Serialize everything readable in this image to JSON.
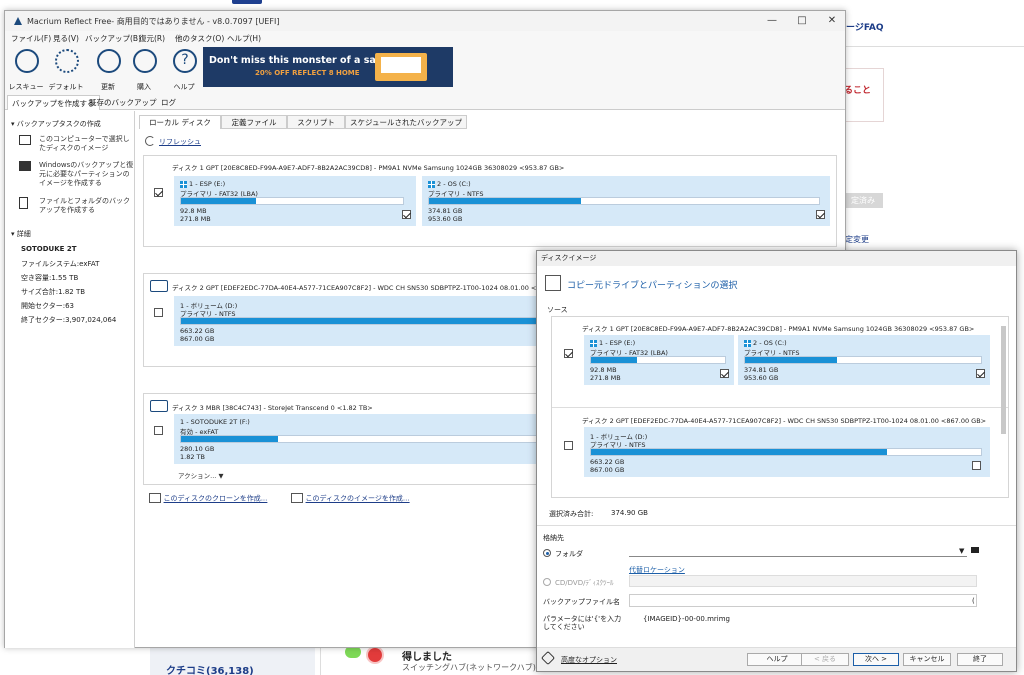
{
  "web": {
    "faq": "ージFAQ",
    "red_text": "ること",
    "btn": "定済み",
    "link": "定変更",
    "review": "クチコミ(36,138)",
    "gain": "得しました",
    "switch": "スイッチングハブ(ネットワークハブ)"
  },
  "main": {
    "title": "Macrium Reflect Free- 商用目的ではありません - v8.0.7097 [UEFI]",
    "menu": [
      "ファイル(F)",
      "見る(V)",
      "バックアップ(B)",
      "復元(R)",
      "他のタスク(O)",
      "ヘルプ(H)"
    ],
    "toolbar": [
      "レスキュー",
      "デフォルト",
      "更新",
      "購入",
      "ヘルプ"
    ],
    "ad_line1": "Don't miss this monster of a sale!",
    "ad_line2": "20% OFF REFLECT 8 HOME",
    "subtabs": [
      "バックアップを作成する",
      "既存のバックアップ",
      "ログ"
    ],
    "left": {
      "head": "バックアップタスクの作成",
      "tasks": [
        "このコンピューターで選択したディスクのイメージ",
        "Windowsのバックアップと復元に必要なパーティションのイメージを作成する",
        "ファイルとフォルダのバックアップを作成する"
      ],
      "detail_head": "詳細",
      "details": [
        "SOTODUKE 2T",
        "ファイルシステム:exFAT",
        "空き容量:1.55 TB",
        "サイズ合計:1.82 TB",
        "開始セクター:63",
        "終了セクター:3,907,024,064"
      ]
    },
    "tabs": [
      "ローカル ディスク",
      "定義ファイル",
      "スクリプト",
      "スケジュールされたバックアップ"
    ],
    "refresh": "リフレッシュ",
    "disks": [
      {
        "title": "ディスク 1 GPT [20E8C8ED-F99A-A9E7-ADF7-8B2A2AC39CD8] - PM9A1 NVMe Samsung 1024GB 36308029  <953.87 GB>",
        "checked": true,
        "parts": [
          {
            "name": "1 - ESP (E:)",
            "type": "プライマリ - FAT32 (LBA)",
            "used": "92.8 MB",
            "total": "271.8 MB",
            "fill": 0.34,
            "checked": true
          },
          {
            "name": "2 - OS (C:)",
            "type": "プライマリ - NTFS",
            "used": "374.81 GB",
            "total": "953.60 GB",
            "fill": 0.39,
            "checked": true
          }
        ]
      },
      {
        "title": "ディスク 2 GPT [EDEF2EDC-77DA-40E4-A577-71CEA907C8F2] - WDC CH SN530 SDBPTPZ-1T00-1024 08.01.00  <867.00 GB>",
        "checked": false,
        "parts": [
          {
            "name": "1 - ボリューム (D:)",
            "type": "プライマリ - NTFS",
            "used": "663.22 GB",
            "total": "867.00 GB",
            "fill": 0.76,
            "checked": false
          }
        ]
      },
      {
        "title": "ディスク 3 MBR [38C4C743] - StoreJet Transcend     0  <1.82 TB>",
        "checked": false,
        "parts": [
          {
            "name": "1 - SOTODUKE 2T (F:)",
            "type": "有効 - exFAT",
            "used": "280.10 GB",
            "total": "1.82 TB",
            "fill": 0.15,
            "checked": false
          }
        ],
        "action": "アクション..."
      }
    ],
    "clone_link": "このディスクのクローンを作成...",
    "image_link": "このディスクのイメージを作成..."
  },
  "dialog": {
    "title": "ディスクイメージ",
    "heading": "コピー元ドライブとパーティションの選択",
    "source": "ソース",
    "disks": [
      {
        "title": "ディスク 1 GPT [20E8C8ED-F99A-A9E7-ADF7-8B2A2AC39CD8] - PM9A1 NVMe Samsung 1024GB 36308029  <953.87 GB>",
        "checked": true,
        "parts": [
          {
            "name": "1 - ESP (E:)",
            "type": "プライマリ - FAT32 (LBA)",
            "used": "92.8 MB",
            "total": "271.8 MB",
            "fill": 0.34,
            "checked": true
          },
          {
            "name": "2 - OS (C:)",
            "type": "プライマリ - NTFS",
            "used": "374.81 GB",
            "total": "953.60 GB",
            "fill": 0.39,
            "checked": true
          }
        ]
      },
      {
        "title": "ディスク 2 GPT [EDEF2EDC-77DA-40E4-A577-71CEA907C8F2] - WDC CH SN530 SDBPTPZ-1T00-1024 08.01.00  <867.00 GB>",
        "checked": false,
        "parts": [
          {
            "name": "1 - ボリューム (D:)",
            "type": "プライマリ - NTFS",
            "used": "663.22 GB",
            "total": "867.00 GB",
            "fill": 0.76,
            "checked": false
          }
        ]
      }
    ],
    "selected_total_label": "選択済み合計:",
    "selected_total": "374.90 GB",
    "dest_label": "格納先",
    "folder": "フォルダ",
    "alt_location": "代替ロケーション",
    "cd": "CD/DVD/ﾃﾞｨｽｸﾂｰﾙ",
    "file_label": "バックアップファイル名",
    "param_label": "パラメータには'{'を入力してください",
    "file_pattern": "{IMAGEID}-00-00.mrimg",
    "advanced": "高度なオプション",
    "buttons": [
      "ヘルプ",
      "< 戻る",
      "次へ >",
      "キャンセル",
      "終了"
    ]
  }
}
